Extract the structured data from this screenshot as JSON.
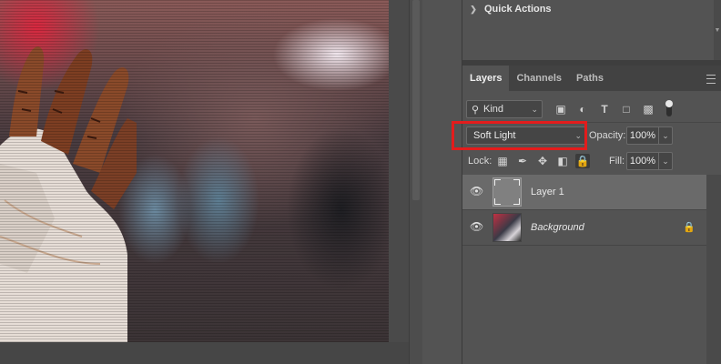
{
  "quick_actions": {
    "title": "Quick Actions"
  },
  "tabs": [
    {
      "label": "Layers",
      "active": true
    },
    {
      "label": "Channels",
      "active": false
    },
    {
      "label": "Paths",
      "active": false
    }
  ],
  "filter": {
    "kind_label": "Kind",
    "icons": [
      "image-filter-icon",
      "adjustment-filter-icon",
      "type-filter-icon",
      "shape-filter-icon",
      "smart-object-filter-icon"
    ]
  },
  "blend": {
    "mode": "Soft Light",
    "opacity_label": "Opacity:",
    "opacity_value": "100%",
    "highlight_color": "#e31c1c"
  },
  "lock": {
    "label": "Lock:",
    "fill_label": "Fill:",
    "fill_value": "100%"
  },
  "layers": [
    {
      "name": "Layer 1",
      "selected": true,
      "visible": true,
      "locked": false
    },
    {
      "name": "Background",
      "selected": false,
      "visible": true,
      "locked": true
    }
  ]
}
